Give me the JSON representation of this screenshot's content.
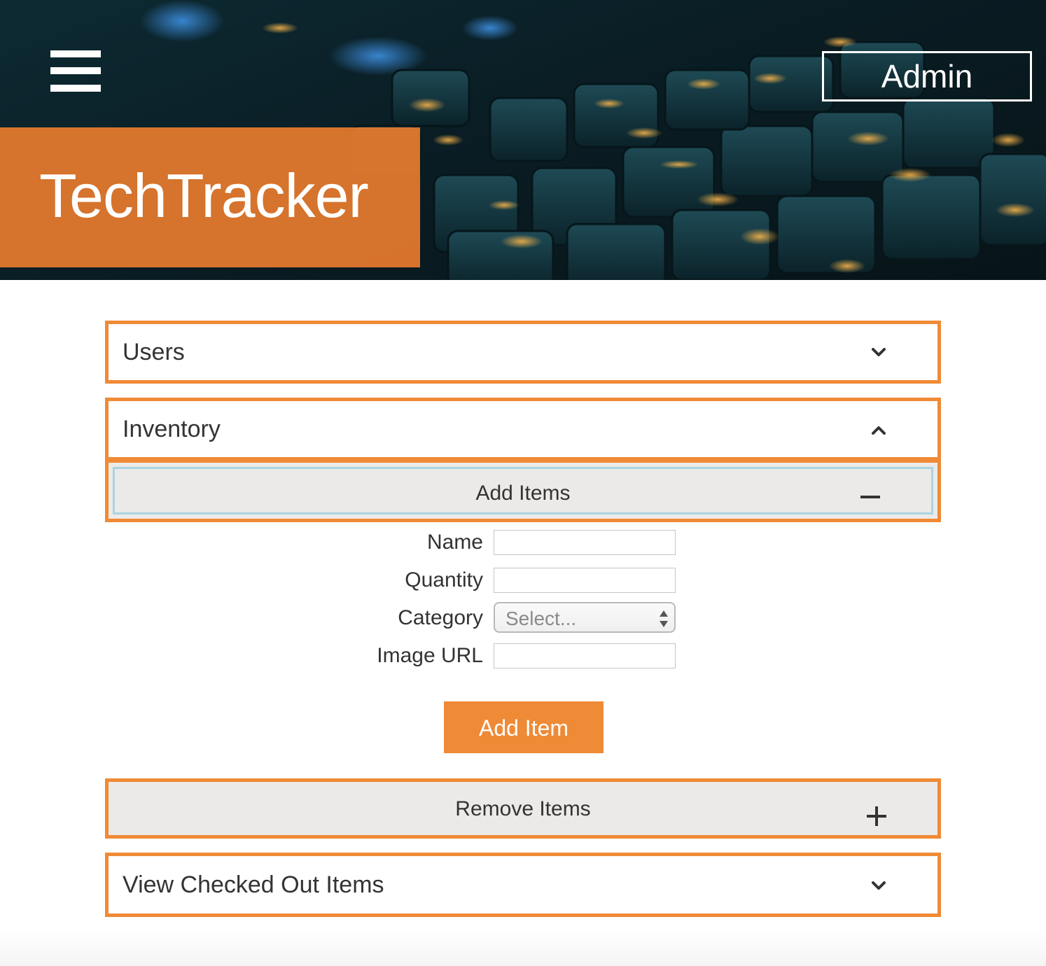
{
  "header": {
    "menu_icon": "hamburger-menu-icon",
    "admin_label": "Admin",
    "brand_title": "TechTracker",
    "brand_color": "#e67a2d"
  },
  "accordion": {
    "accent_color": "#ef8a36",
    "sections": {
      "users": {
        "label": "Users",
        "icon": "chevron-down-icon",
        "expanded": false
      },
      "inventory": {
        "label": "Inventory",
        "icon": "chevron-up-icon",
        "expanded": true,
        "subsections": {
          "add_items": {
            "label": "Add Items",
            "icon": "minus-icon",
            "expanded": true
          },
          "remove_items": {
            "label": "Remove Items",
            "icon": "plus-icon",
            "expanded": false
          }
        }
      },
      "checked_out": {
        "label": "View Checked Out Items",
        "icon": "chevron-down-icon",
        "expanded": false
      }
    }
  },
  "form": {
    "name_label": "Name",
    "name_value": "",
    "quantity_label": "Quantity",
    "quantity_value": "",
    "category_label": "Category",
    "category_selected": "Select...",
    "image_url_label": "Image URL",
    "image_url_value": "",
    "submit_label": "Add Item"
  }
}
